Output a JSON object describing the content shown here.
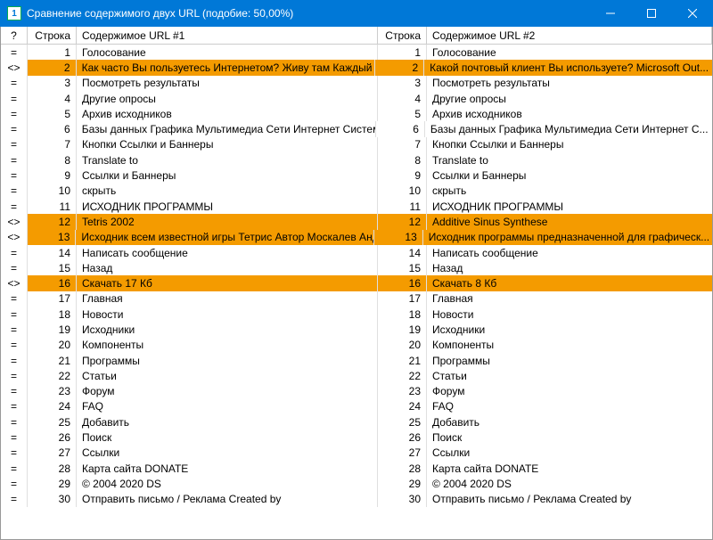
{
  "window": {
    "title": "Сравнение содержимого двух URL (подобие: 50,00%)"
  },
  "headers": {
    "marker": "?",
    "lineL": "Строка",
    "textL": "Содержимое URL #1",
    "lineR": "Строка",
    "textR": "Содержимое URL #2"
  },
  "rows": [
    {
      "m": "=",
      "nL": 1,
      "tL": "Голосование",
      "nR": 1,
      "tR": "Голосование",
      "diff": false
    },
    {
      "m": "<>",
      "nL": 2,
      "tL": "Как часто Вы пользуетесь Интернетом? Живу там Каждый де...",
      "nR": 2,
      "tR": "Какой почтовый клиент Вы используете? Microsoft Out...",
      "diff": true
    },
    {
      "m": "=",
      "nL": 3,
      "tL": "Посмотреть результаты",
      "nR": 3,
      "tR": "Посмотреть результаты",
      "diff": false
    },
    {
      "m": "=",
      "nL": 4,
      "tL": "Другие опросы",
      "nR": 4,
      "tR": "Другие опросы",
      "diff": false
    },
    {
      "m": "=",
      "nL": 5,
      "tL": "Архив исходников",
      "nR": 5,
      "tR": "Архив исходников",
      "diff": false
    },
    {
      "m": "=",
      "nL": 6,
      "tL": "Базы данных Графика Мультимедиа Сети Интернет Система ...",
      "nR": 6,
      "tR": "Базы данных Графика Мультимедиа Сети Интернет С...",
      "diff": false
    },
    {
      "m": "=",
      "nL": 7,
      "tL": "Кнопки Ссылки и Баннеры",
      "nR": 7,
      "tR": "Кнопки Ссылки и Баннеры",
      "diff": false
    },
    {
      "m": "=",
      "nL": 8,
      "tL": "Translate to",
      "nR": 8,
      "tR": "Translate to",
      "diff": false
    },
    {
      "m": "=",
      "nL": 9,
      "tL": "Ссылки и Баннеры",
      "nR": 9,
      "tR": "Ссылки и Баннеры",
      "diff": false
    },
    {
      "m": "=",
      "nL": 10,
      "tL": "скрыть",
      "nR": 10,
      "tR": "скрыть",
      "diff": false
    },
    {
      "m": "=",
      "nL": 11,
      "tL": "ИСХОДНИК ПРОГРАММЫ",
      "nR": 11,
      "tR": "ИСХОДНИК ПРОГРАММЫ",
      "diff": false
    },
    {
      "m": "<>",
      "nL": 12,
      "tL": "Tetris 2002",
      "nR": 12,
      "tR": "Additive Sinus Synthese",
      "diff": true
    },
    {
      "m": "<>",
      "nL": 13,
      "tL": "Исходник всем известной игры Тетрис Автор Москалев Андрей",
      "nR": 13,
      "tR": "Исходник программы предназначенной для графическ...",
      "diff": true
    },
    {
      "m": "=",
      "nL": 14,
      "tL": "Написать сообщение",
      "nR": 14,
      "tR": "Написать сообщение",
      "diff": false
    },
    {
      "m": "=",
      "nL": 15,
      "tL": "Назад",
      "nR": 15,
      "tR": "Назад",
      "diff": false
    },
    {
      "m": "<>",
      "nL": 16,
      "tL": "Скачать 17 Кб",
      "nR": 16,
      "tR": "Скачать 8 Кб",
      "diff": true
    },
    {
      "m": "=",
      "nL": 17,
      "tL": "Главная",
      "nR": 17,
      "tR": "Главная",
      "diff": false
    },
    {
      "m": "=",
      "nL": 18,
      "tL": "Новости",
      "nR": 18,
      "tR": "Новости",
      "diff": false
    },
    {
      "m": "=",
      "nL": 19,
      "tL": "Исходники",
      "nR": 19,
      "tR": "Исходники",
      "diff": false
    },
    {
      "m": "=",
      "nL": 20,
      "tL": "Компоненты",
      "nR": 20,
      "tR": "Компоненты",
      "diff": false
    },
    {
      "m": "=",
      "nL": 21,
      "tL": "Программы",
      "nR": 21,
      "tR": "Программы",
      "diff": false
    },
    {
      "m": "=",
      "nL": 22,
      "tL": "Статьи",
      "nR": 22,
      "tR": "Статьи",
      "diff": false
    },
    {
      "m": "=",
      "nL": 23,
      "tL": "Форум",
      "nR": 23,
      "tR": "Форум",
      "diff": false
    },
    {
      "m": "=",
      "nL": 24,
      "tL": "FAQ",
      "nR": 24,
      "tR": "FAQ",
      "diff": false
    },
    {
      "m": "=",
      "nL": 25,
      "tL": "Добавить",
      "nR": 25,
      "tR": "Добавить",
      "diff": false
    },
    {
      "m": "=",
      "nL": 26,
      "tL": "Поиск",
      "nR": 26,
      "tR": "Поиск",
      "diff": false
    },
    {
      "m": "=",
      "nL": 27,
      "tL": "Ссылки",
      "nR": 27,
      "tR": "Ссылки",
      "diff": false
    },
    {
      "m": "=",
      "nL": 28,
      "tL": "Карта сайта DONATE",
      "nR": 28,
      "tR": "Карта сайта DONATE",
      "diff": false
    },
    {
      "m": "=",
      "nL": 29,
      "tL": "© 2004 2020 DS",
      "nR": 29,
      "tR": "© 2004 2020 DS",
      "diff": false
    },
    {
      "m": "=",
      "nL": 30,
      "tL": "Отправить письмо / Реклама Created by",
      "nR": 30,
      "tR": "Отправить письмо / Реклама Created by",
      "diff": false
    }
  ]
}
